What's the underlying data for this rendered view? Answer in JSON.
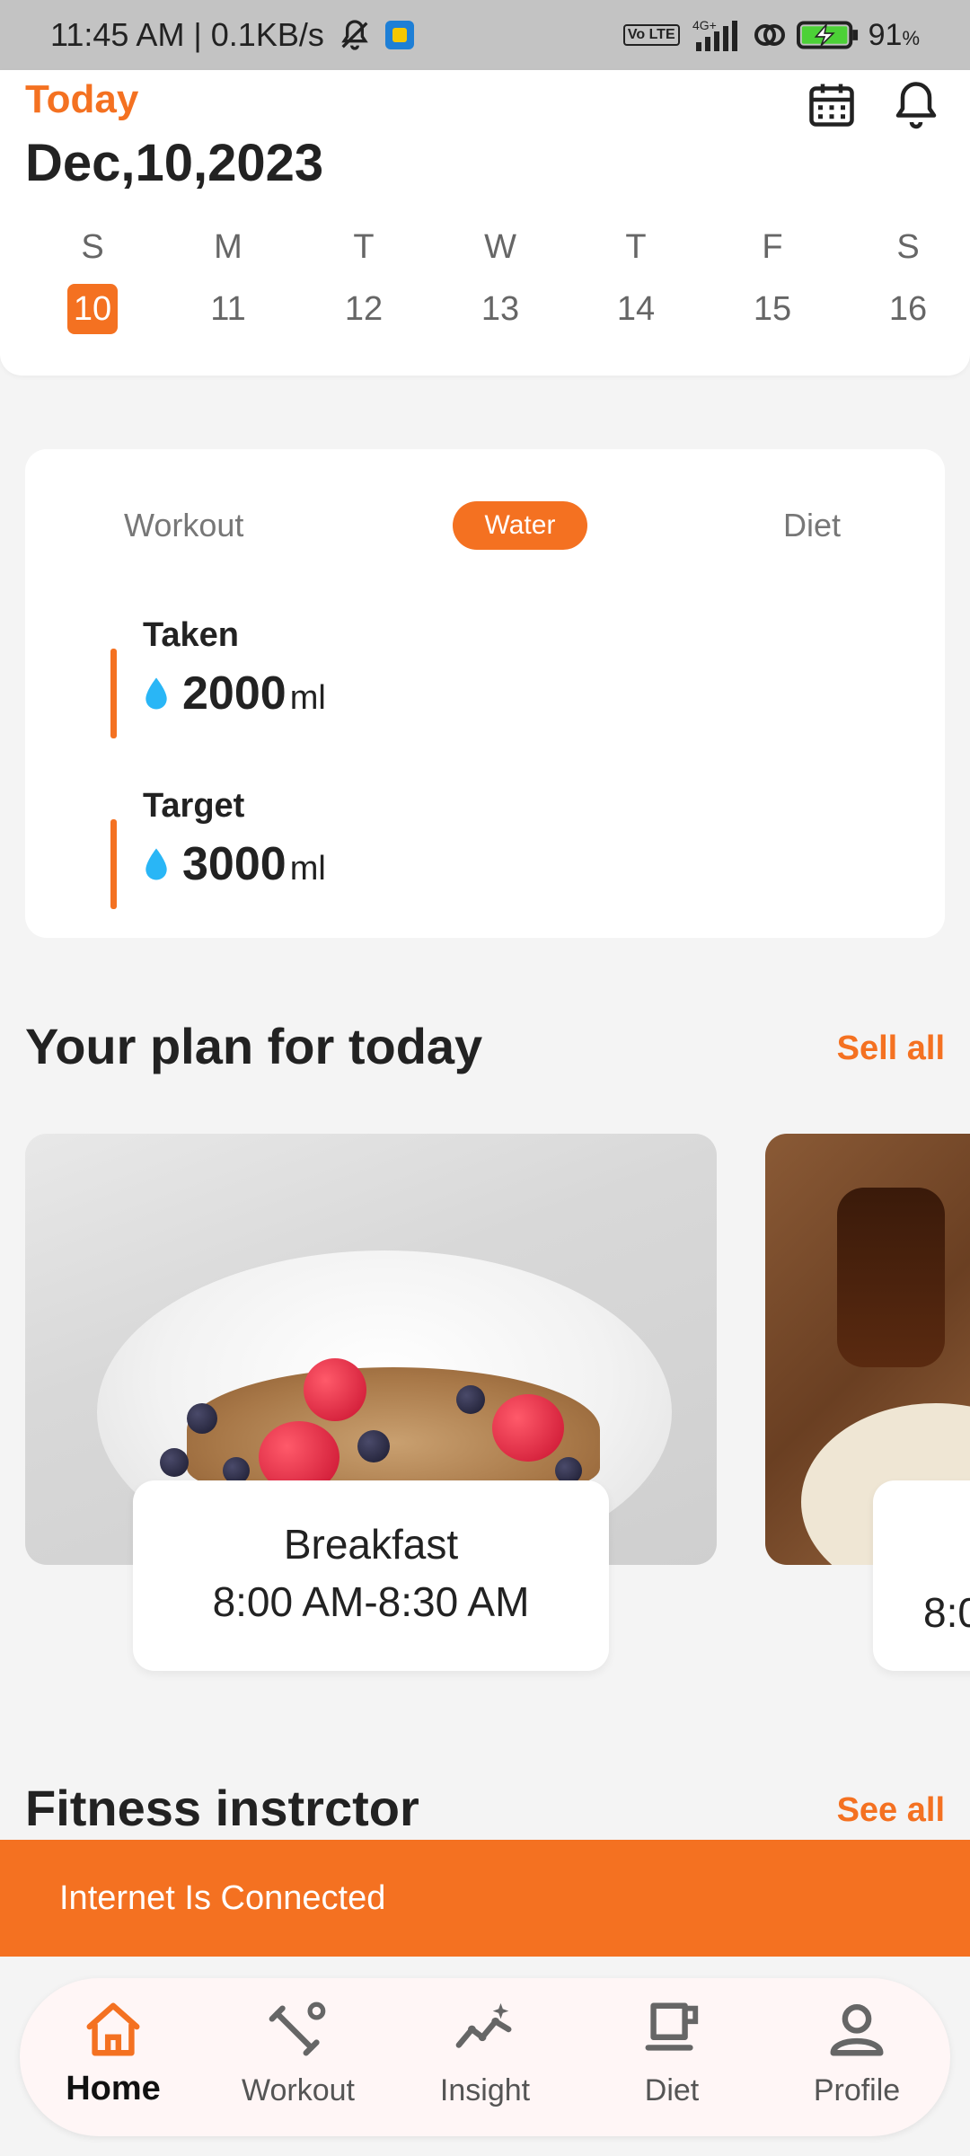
{
  "status_bar": {
    "time_speed": "11:45 AM | 0.1KB/s",
    "network": "4G+",
    "volte": "Vo LTE",
    "battery": "91",
    "battery_unit": "%"
  },
  "header": {
    "today_label": "Today",
    "date": "Dec,10,2023",
    "icons": [
      "calendar-icon",
      "bell-icon"
    ]
  },
  "week": [
    {
      "letter": "S",
      "num": "10",
      "active": true
    },
    {
      "letter": "M",
      "num": "11",
      "active": false
    },
    {
      "letter": "T",
      "num": "12",
      "active": false
    },
    {
      "letter": "W",
      "num": "13",
      "active": false
    },
    {
      "letter": "T",
      "num": "14",
      "active": false
    },
    {
      "letter": "F",
      "num": "15",
      "active": false
    },
    {
      "letter": "S",
      "num": "16",
      "active": false
    }
  ],
  "tracker": {
    "tabs": [
      "Workout",
      "Water",
      "Diet"
    ],
    "selected_tab": "Water",
    "taken": {
      "label": "Taken",
      "value": "2000",
      "unit": "ml"
    },
    "target": {
      "label": "Target",
      "value": "3000",
      "unit": "ml"
    }
  },
  "plan": {
    "title": "Your plan for today",
    "link": "Sell all",
    "meals": [
      {
        "name": "Breakfast",
        "time": "8:00 AM-8:30 AM"
      },
      {
        "name": "",
        "time": "8:0"
      }
    ]
  },
  "fitness": {
    "title": "Fitness instrctor",
    "link": "See all"
  },
  "snackbar": {
    "text": "Internet Is Connected"
  },
  "bottom_nav": {
    "items": [
      "Home",
      "Workout",
      "Insight",
      "Diet",
      "Profile"
    ],
    "active": "Home"
  },
  "colors": {
    "accent": "#f47121",
    "water_drop": "#29b6f6"
  }
}
